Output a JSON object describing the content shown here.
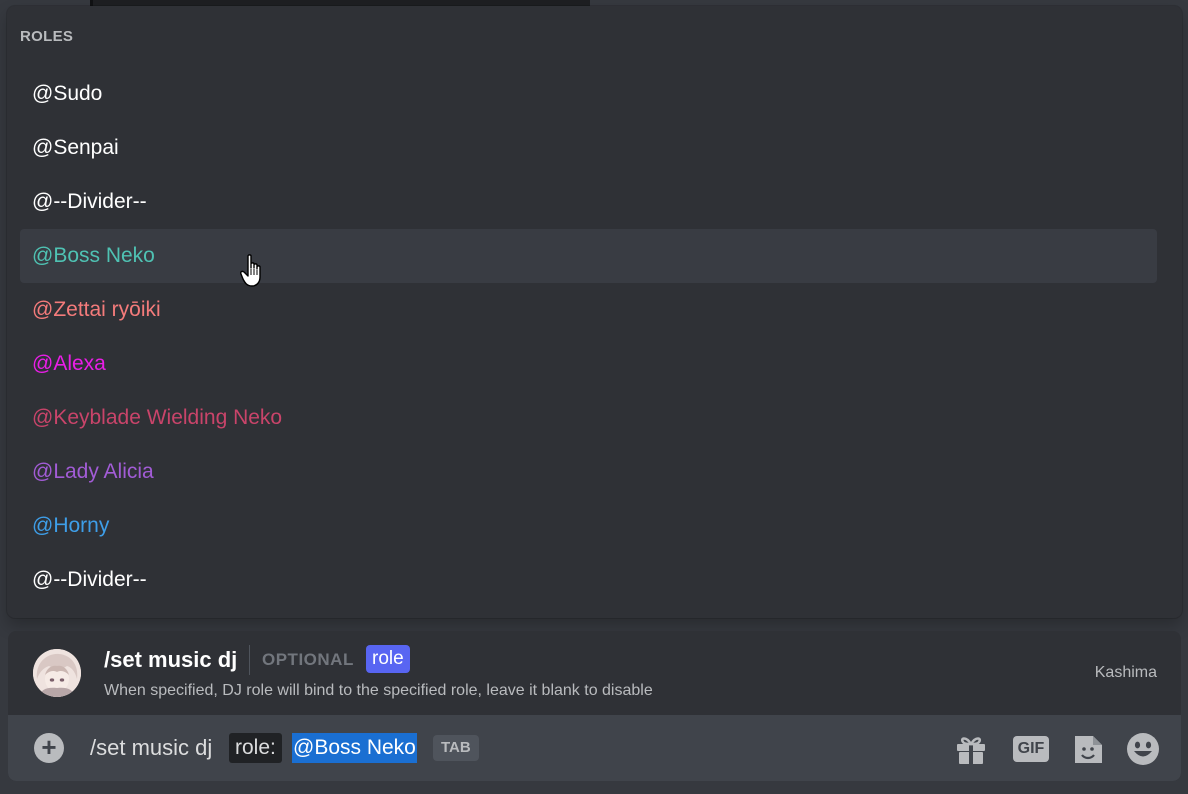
{
  "popup": {
    "header": "ROLES",
    "roles": [
      {
        "label": "@Sudo",
        "color": "#ffffff"
      },
      {
        "label": "@Senpai",
        "color": "#ffffff"
      },
      {
        "label": "@--Divider--",
        "color": "#ffffff"
      },
      {
        "label": "@Boss Neko",
        "color": "#4fc2b3",
        "selected": true
      },
      {
        "label": "@Zettai ryōiki",
        "color": "#f47b7b"
      },
      {
        "label": "@Alexa",
        "color": "#e91ee6"
      },
      {
        "label": "@Keyblade Wielding Neko",
        "color": "#c9446a"
      },
      {
        "label": "@Lady Alicia",
        "color": "#a25cd6"
      },
      {
        "label": "@Horny",
        "color": "#3e9ee8"
      },
      {
        "label": "@--Divider--",
        "color": "#ffffff"
      }
    ]
  },
  "command": {
    "name": "/set music dj",
    "optional": "OPTIONAL",
    "option_pill": "role",
    "description": "When specified, DJ role will bind to the specified role, leave it blank to disable",
    "app": "Kashima"
  },
  "input": {
    "command_text": "/set music dj",
    "option_label": "role:",
    "option_value": "@Boss Neko",
    "tab_hint": "TAB",
    "gif_label": "GIF"
  },
  "icons": {
    "add": "plus-circle-icon",
    "gift": "gift-icon",
    "gif": "gif-icon",
    "sticker": "sticker-icon",
    "emoji": "emoji-icon",
    "cursor": "hand-cursor-icon"
  },
  "colors": {
    "accent": "#5865f2",
    "selection": "#1a6fd2"
  }
}
